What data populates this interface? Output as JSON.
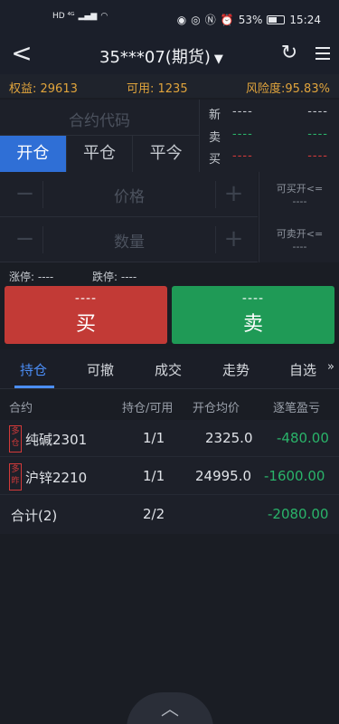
{
  "status_bar": {
    "left_icons": "HD ⁴ᴳ",
    "battery": "53%",
    "time": "15:24"
  },
  "navbar": {
    "back_glyph": "<",
    "title": "35***07(期货)",
    "caret": "▼"
  },
  "account": {
    "equity": "权益: 29613",
    "available": "可用: 1235",
    "risk": "风险度:95.83%"
  },
  "contract_input": {
    "placeholder": "合约代码"
  },
  "order_tabs": [
    "开仓",
    "平仓",
    "平今"
  ],
  "quote": {
    "rows": [
      {
        "label": "新",
        "v1": "----",
        "v2": "----"
      },
      {
        "label": "卖",
        "v1": "----",
        "v2": "----"
      },
      {
        "label": "买",
        "v1": "----",
        "v2": "----"
      }
    ]
  },
  "price_field": {
    "placeholder": "价格"
  },
  "qty_field": {
    "placeholder": "数量"
  },
  "can_open": {
    "buy_label": "可买开<=",
    "buy_value": "----",
    "sell_label": "可卖开<=",
    "sell_value": "----"
  },
  "limits": {
    "up": "涨停: ----",
    "down": "跌停: ----"
  },
  "buy_button": {
    "price": "----",
    "label": "买"
  },
  "sell_button": {
    "price": "----",
    "label": "卖"
  },
  "bottom_tabs": [
    "持仓",
    "可撤",
    "成交",
    "走势",
    "自选"
  ],
  "table": {
    "headers": [
      "合约",
      "持仓/可用",
      "开仓均价",
      "逐笔盈亏"
    ],
    "rows": [
      {
        "tag": "多仓",
        "contract": "纯碱2301",
        "position": "1/1",
        "avg_price": "2325.0",
        "pnl": "-480.00"
      },
      {
        "tag": "多昨",
        "contract": "沪锌2210",
        "position": "1/1",
        "avg_price": "24995.0",
        "pnl": "-1600.00"
      }
    ],
    "total": {
      "label": "合计(2)",
      "position": "2/2",
      "pnl": "-2080.00"
    }
  },
  "colors": {
    "accent": "#2f6fd6",
    "buy": "#c23a36",
    "sell": "#1f9a56",
    "warn": "#e0a43c"
  }
}
